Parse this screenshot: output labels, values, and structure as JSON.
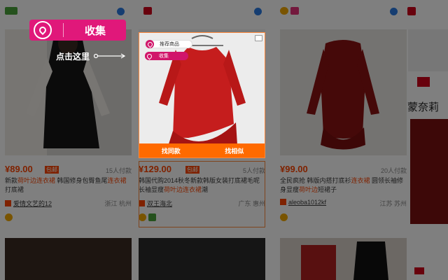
{
  "products": [
    {
      "price": "¥89.00",
      "tag": "包邮",
      "sold": "15人付款",
      "desc_prefix": "新款",
      "desc_hl1": "荷叶边连衣裙",
      "desc_mid": " 韩国修身包臀鱼尾",
      "desc_hl2": "连衣裙",
      "desc_end": "打底裙",
      "shop": "爱情文艺的12",
      "location": "浙江 杭州"
    },
    {
      "price": "¥129.00",
      "tag": "包邮",
      "sold": "5人付款",
      "desc_prefix": "韩国代购2014秋冬新款韩版女装打底裙毛",
      "desc_hl1": "呢长袖显瘦",
      "desc_mid": "",
      "desc_hl2": "荷叶边连衣裙",
      "desc_end": "潮",
      "shop": "双王海北",
      "location": "广东 惠州"
    },
    {
      "price": "¥99.00",
      "tag": "",
      "sold": "20人付款",
      "desc_prefix": "全民疯抢 韩版内搭打底衫",
      "desc_hl1": "连衣裙",
      "desc_mid": " 圆领长袖修身显瘦",
      "desc_hl2": "荷叶边",
      "desc_end": "短裙子",
      "shop": "aleoba1012kf",
      "location": "江苏 苏州"
    }
  ],
  "popup": {
    "recommend_label": "推荐商品",
    "collect_small": "收集",
    "find_same": "找同款",
    "find_similar": "找相似"
  },
  "callout": {
    "collect_label": "收集",
    "click_here": "点击这里"
  },
  "right_text": "蒙奈莉",
  "colors": {
    "accent_pink": "#e0187a",
    "price_orange": "#ff4400",
    "action_orange": "#ff6a00"
  }
}
